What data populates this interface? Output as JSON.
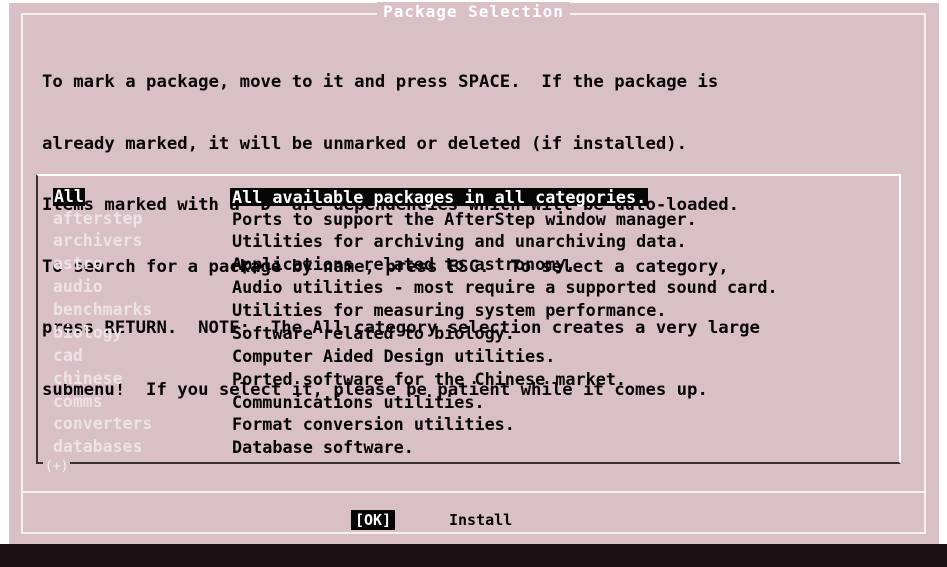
{
  "dialog": {
    "title": "Package Selection",
    "prompt_lines": [
      "To mark a package, move to it and press SPACE.  If the package is",
      "already marked, it will be unmarked or deleted (if installed).",
      "Items marked with a `D' are dependencies which will be auto-loaded.",
      "To search for a package by name, press ESC.  To select a category,",
      "press RETURN.  NOTE:  The All category selection creates a very large",
      "submenu!  If you select it, please be patient while it comes up."
    ]
  },
  "categories": [
    {
      "tag": "All",
      "desc": "All available packages in all categories.",
      "selected": true
    },
    {
      "tag": "afterstep",
      "desc": "Ports to support the AfterStep window manager.",
      "selected": false
    },
    {
      "tag": "archivers",
      "desc": "Utilities for archiving and unarchiving data.",
      "selected": false
    },
    {
      "tag": "astro",
      "desc": "Applications related to astronomy.",
      "selected": false
    },
    {
      "tag": "audio",
      "desc": "Audio utilities - most require a supported sound card.",
      "selected": false
    },
    {
      "tag": "benchmarks",
      "desc": "Utilities for measuring system performance.",
      "selected": false
    },
    {
      "tag": "biology",
      "desc": "Software related to biology.",
      "selected": false
    },
    {
      "tag": "cad",
      "desc": "Computer Aided Design utilities.",
      "selected": false
    },
    {
      "tag": "chinese",
      "desc": "Ported software for the Chinese market.",
      "selected": false
    },
    {
      "tag": "comms",
      "desc": "Communications utilities.",
      "selected": false
    },
    {
      "tag": "converters",
      "desc": "Format conversion utilities.",
      "selected": false
    },
    {
      "tag": "databases",
      "desc": "Database software.",
      "selected": false
    }
  ],
  "list": {
    "more_indicator": "(+)"
  },
  "buttons": {
    "ok_label": "[OK]",
    "install_label": "Install"
  },
  "colors": {
    "dialog_bg": "#d9bfc6",
    "text": "#050405",
    "highlight_bg": "#050505",
    "highlight_text": "#ffffff"
  }
}
